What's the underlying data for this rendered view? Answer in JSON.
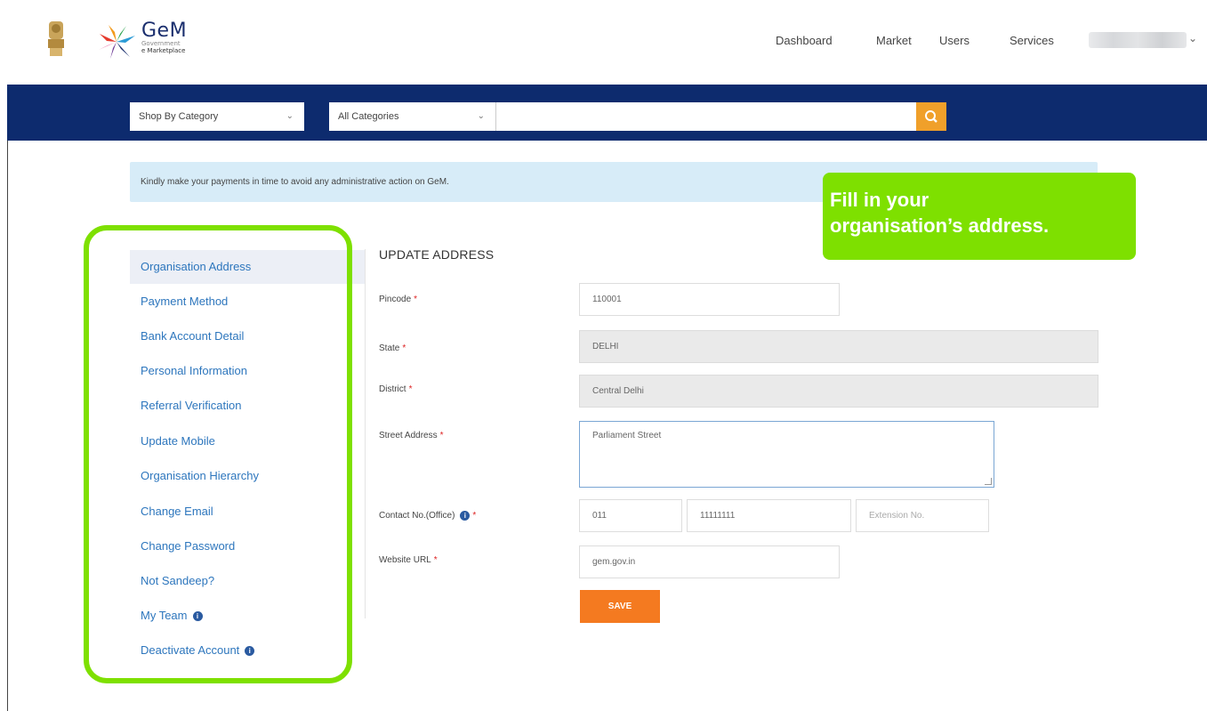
{
  "logo": {
    "title": "GeM",
    "sub1": "Government",
    "sub2": "e Marketplace"
  },
  "nav": {
    "dashboard": "Dashboard",
    "market": "Market",
    "users": "Users",
    "services": "Services"
  },
  "search": {
    "shop_by_category": "Shop By Category",
    "all_categories": "All Categories",
    "placeholder": ""
  },
  "alert": {
    "text": "Kindly make your payments in time to avoid any administrative action on GeM."
  },
  "callout": {
    "line1": "Fill in your",
    "line2": "organisation’s address."
  },
  "sidebar": {
    "items": [
      {
        "label": "Organisation Address",
        "active": true
      },
      {
        "label": "Payment Method"
      },
      {
        "label": "Bank Account Detail"
      },
      {
        "label": "Personal Information"
      },
      {
        "label": "Referral Verification"
      },
      {
        "label": "Update Mobile"
      },
      {
        "label": "Organisation Hierarchy"
      },
      {
        "label": "Change Email"
      },
      {
        "label": "Change Password"
      },
      {
        "label": "Not Sandeep?"
      },
      {
        "label": "My Team"
      },
      {
        "label": "Deactivate Account"
      }
    ]
  },
  "form": {
    "title": "UPDATE ADDRESS",
    "required_mark": "*",
    "pincode_label": "Pincode",
    "pincode_value": "110001",
    "state_label": "State",
    "state_value": "DELHI",
    "district_label": "District",
    "district_value": "Central Delhi",
    "street_label": "Street Address",
    "street_value": "Parliament Street",
    "contact_label": "Contact No.(Office)",
    "contact_std": "011",
    "contact_number": "11111111",
    "contact_ext_placeholder": "Extension No.",
    "website_label": "Website URL",
    "website_value": "gem.gov.in",
    "save_label": "SAVE"
  },
  "colors": {
    "navy": "#0d2b6e",
    "orange": "#f47a20",
    "search_orange": "#f0a02a",
    "highlight_green": "#7ee000",
    "link_blue": "#2d76bd"
  },
  "icons": [
    "national-emblem-icon",
    "gem-star-logo-icon",
    "search-icon",
    "chevron-down-icon",
    "info-icon"
  ]
}
